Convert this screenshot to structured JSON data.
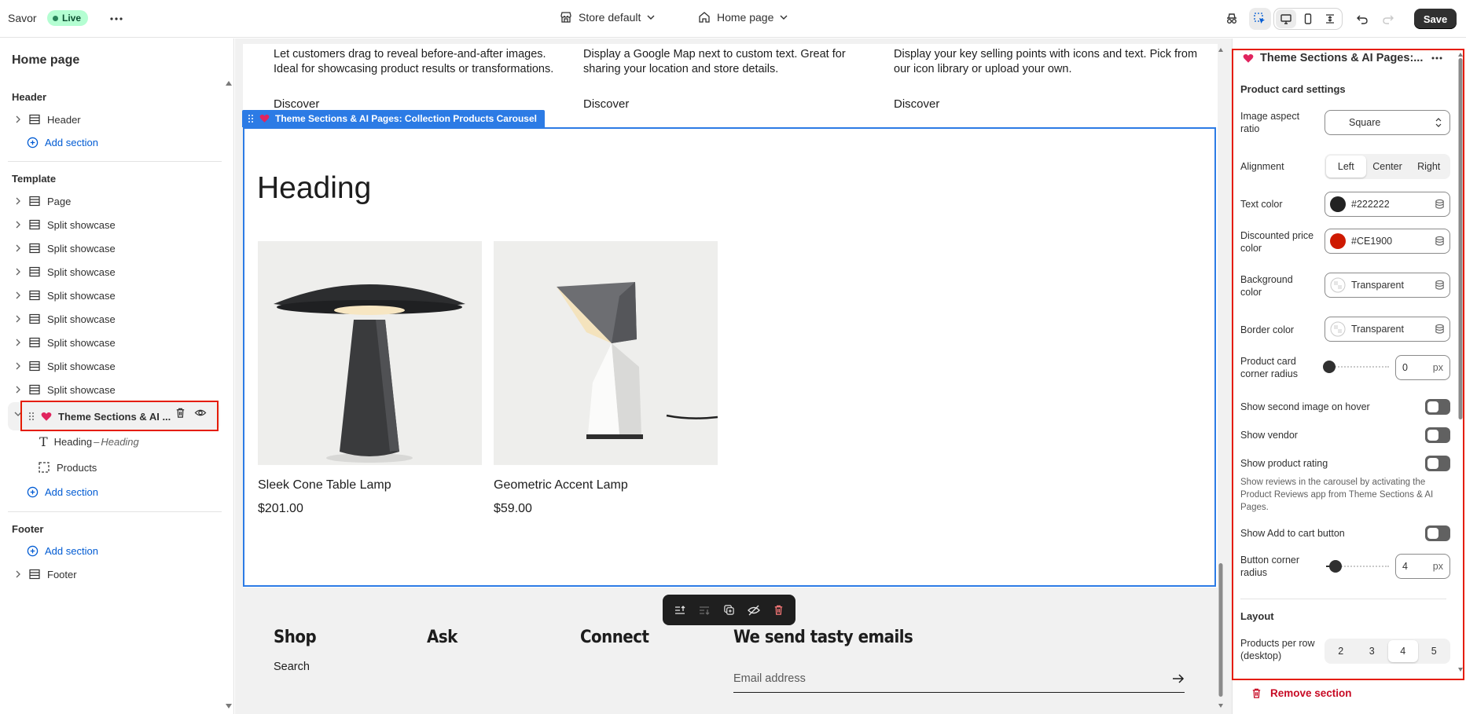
{
  "topbar": {
    "store_name": "Savor",
    "status": "Live",
    "store_select": "Store default",
    "page_select": "Home page",
    "save_label": "Save"
  },
  "left_panel": {
    "title": "Home page",
    "header_group": "Header",
    "header_item": "Header",
    "add_section": "Add section",
    "template_group": "Template",
    "template_items": [
      "Page",
      "Split showcase",
      "Split showcase",
      "Split showcase",
      "Split showcase",
      "Split showcase",
      "Split showcase",
      "Split showcase",
      "Split showcase"
    ],
    "selected_section": "Theme Sections & AI ...",
    "blocks": {
      "heading_label": "Heading",
      "heading_sub": "Heading",
      "products_label": "Products"
    },
    "footer_group": "Footer",
    "footer_item": "Footer"
  },
  "preview": {
    "features": [
      {
        "text": "Let customers drag to reveal before-and-after images. Ideal for showcasing product results or transformations.",
        "link": "Discover"
      },
      {
        "text": "Display a Google Map next to custom text. Great for sharing your location and store details.",
        "link": "Discover"
      },
      {
        "text": "Display your key selling points with icons and text. Pick from our icon library or upload your own.",
        "link": "Discover"
      }
    ],
    "section_label": "Theme Sections & AI Pages: Collection Products Carousel",
    "heading": "Heading",
    "products": [
      {
        "name": "Sleek Cone Table Lamp",
        "price": "$201.00"
      },
      {
        "name": "Geometric Accent Lamp",
        "price": "$59.00"
      }
    ],
    "footer": {
      "col1_title": "Shop",
      "col1_link": "Search",
      "col2_title": "Ask",
      "col3_title": "Connect",
      "newsletter_title": "We send tasty emails",
      "email_placeholder": "Email address"
    }
  },
  "right_panel": {
    "title": "Theme Sections & AI Pages:...",
    "settings_heading": "Product card settings",
    "image_aspect_label": "Image aspect ratio",
    "image_aspect_value": "Square",
    "alignment_label": "Alignment",
    "alignment_options": [
      "Left",
      "Center",
      "Right"
    ],
    "text_color_label": "Text color",
    "text_color_value": "#222222",
    "discount_color_label": "Discounted price color",
    "discount_color_value": "#CE1900",
    "bg_color_label": "Background color",
    "bg_color_value": "Transparent",
    "border_color_label": "Border color",
    "border_color_value": "Transparent",
    "card_radius_label": "Product card corner radius",
    "card_radius_value": "0",
    "px": "px",
    "second_image_label": "Show second image on hover",
    "vendor_label": "Show vendor",
    "rating_label": "Show product rating",
    "rating_help": "Show reviews in the carousel by activating the Product Reviews app from Theme Sections & AI Pages.",
    "add_to_cart_label": "Show Add to cart button",
    "button_radius_label": "Button corner radius",
    "button_radius_value": "4",
    "layout_heading": "Layout",
    "per_row_label": "Products per row (desktop)",
    "per_row_options": [
      "2",
      "3",
      "4",
      "5"
    ],
    "per_row_selected": "4",
    "remove_label": "Remove section"
  },
  "colors": {
    "accent": "#2c7be5",
    "highlight": "#e51c00",
    "text_color": "#222222",
    "discount_color": "#CE1900",
    "live_bg": "#b4fed2"
  }
}
